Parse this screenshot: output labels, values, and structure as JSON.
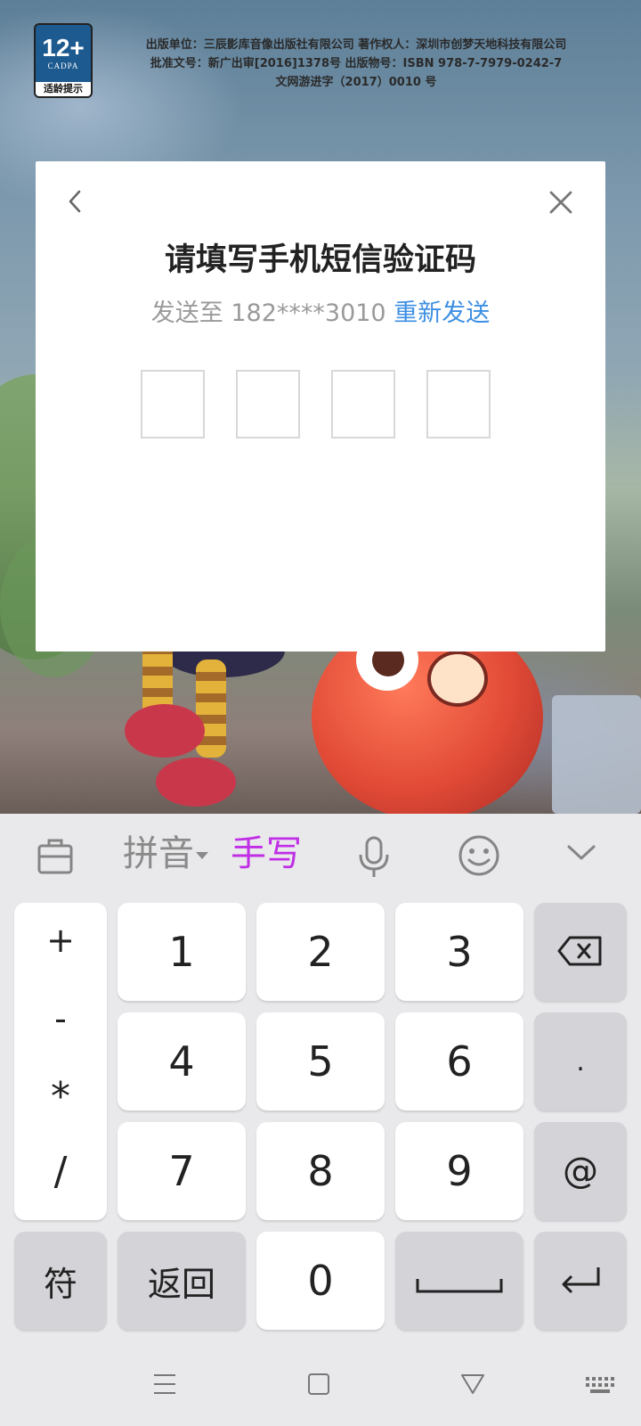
{
  "background": {
    "rating_badge": {
      "age": "12+",
      "org": "CADPA",
      "hint": "适龄提示"
    },
    "publisher_lines": [
      "出版单位：三辰影库音像出版社有限公司 著作权人：深圳市创梦天地科技有限公司",
      "批准文号：新广出审[2016]1378号 出版物号：ISBN 978-7-7979-0242-7",
      "文网游进字（2017）0010 号"
    ]
  },
  "dialog": {
    "back_icon": "chevron-left-icon",
    "close_icon": "close-icon",
    "title": "请填写手机短信验证码",
    "sent_prefix": "发送至 182****3010",
    "resend_label": "重新发送",
    "code_digits": [
      "",
      "",
      "",
      ""
    ]
  },
  "keyboard": {
    "toolbar": {
      "clipboard_icon": "clipboard-icon",
      "pinyin_label": "拼音",
      "handwriting_label": "手写",
      "mic_icon": "microphone-icon",
      "emoji_icon": "emoji-icon",
      "collapse_icon": "chevron-down-icon"
    },
    "symbols": [
      "+",
      "-",
      "*",
      "/"
    ],
    "digits": [
      "1",
      "2",
      "3",
      "4",
      "5",
      "6",
      "7",
      "8",
      "9",
      "0"
    ],
    "dot_label": ".",
    "at_label": "@",
    "symbol_key_label": "符",
    "back_key_label": "返回",
    "backspace_icon": "backspace-icon",
    "space_icon": "space-icon",
    "enter_icon": "enter-icon"
  },
  "navbar": {
    "menu_icon": "menu-icon",
    "home_icon": "home-icon",
    "back_icon": "back-triangle-icon",
    "keyboard_icon": "keyboard-icon"
  },
  "colors": {
    "resend_link": "#3d8fe3",
    "handwriting_accent": "#c02fe6",
    "keyboard_background": "#e9e9eb",
    "function_key": "#d3d3d8"
  }
}
